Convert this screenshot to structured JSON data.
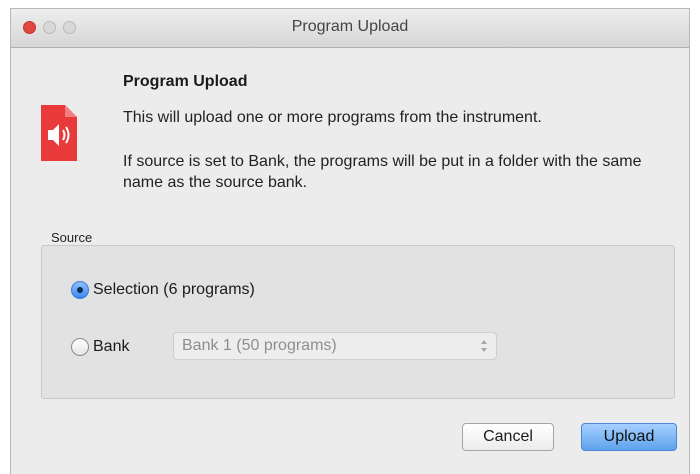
{
  "window": {
    "title": "Program Upload"
  },
  "dialog": {
    "heading": "Program Upload",
    "message_1": "This will upload one or more programs from the instrument.",
    "message_2": "If source is set to Bank, the programs will be put in a folder with the same name as the source bank.",
    "icon": "speaker-icon",
    "icon_color": "#e8393b"
  },
  "source": {
    "label": "Source",
    "options": [
      {
        "label": "Selection (6 programs)",
        "selected": true
      },
      {
        "label": "Bank",
        "selected": false
      }
    ],
    "bank_select": {
      "value": "Bank 1 (50 programs)",
      "enabled": false
    }
  },
  "buttons": {
    "cancel": "Cancel",
    "upload": "Upload"
  },
  "colors": {
    "accent": "#5fa2ec",
    "close": "#e0453f"
  }
}
